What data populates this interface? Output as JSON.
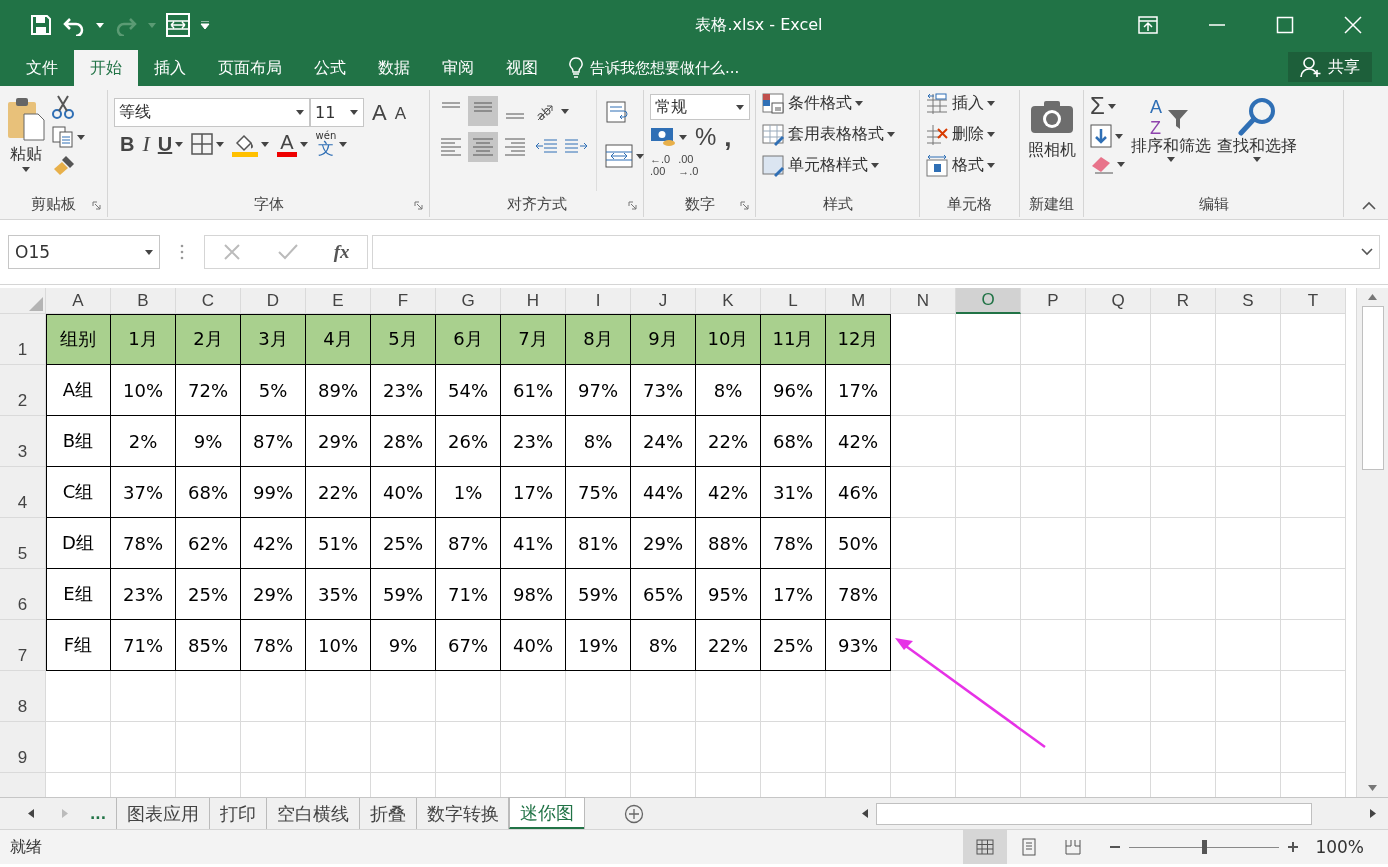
{
  "window": {
    "title": "表格.xlsx - Excel"
  },
  "menu_tabs": [
    {
      "label": "文件",
      "selected": false
    },
    {
      "label": "开始",
      "selected": true
    },
    {
      "label": "插入",
      "selected": false
    },
    {
      "label": "页面布局",
      "selected": false
    },
    {
      "label": "公式",
      "selected": false
    },
    {
      "label": "数据",
      "selected": false
    },
    {
      "label": "审阅",
      "selected": false
    },
    {
      "label": "视图",
      "selected": false
    }
  ],
  "tell_me": {
    "placeholder": "告诉我您想要做什么..."
  },
  "share": "共享",
  "ribbon": {
    "clipboard": {
      "label": "剪贴板",
      "paste": "粘贴"
    },
    "font": {
      "label": "字体",
      "font_name": "等线",
      "font_size": "11",
      "grow": "A",
      "shrink": "A",
      "bold": "B",
      "italic": "I",
      "underline": "U",
      "font_color": "A",
      "phonetic_top": "wén",
      "phonetic_bottom": "文"
    },
    "alignment": {
      "label": "对齐方式",
      "orientation": "ab"
    },
    "number": {
      "label": "数字",
      "format": "常规",
      "percent": "%",
      "comma": ",",
      "increase_decimal": [
        "←.0",
        ".00"
      ],
      "decrease_decimal": [
        ".00",
        "→.0"
      ]
    },
    "styles": {
      "label": "样式",
      "items": [
        "条件格式",
        "套用表格格式",
        "单元格样式"
      ]
    },
    "cells": {
      "label": "单元格",
      "items": [
        "插入",
        "删除",
        "格式"
      ]
    },
    "new_group": {
      "label": "新建组",
      "camera": "照相机"
    },
    "editing": {
      "label": "编辑",
      "sum": "Σ",
      "sort_letters": [
        "A",
        "Z"
      ],
      "items": [
        "排序和筛选",
        "查找和选择"
      ]
    }
  },
  "formula_bar": {
    "name_box": "O15",
    "fx": "fx"
  },
  "sheet": {
    "columns": [
      {
        "label": "A",
        "selected": false
      },
      {
        "label": "B",
        "selected": false
      },
      {
        "label": "C",
        "selected": false
      },
      {
        "label": "D",
        "selected": false
      },
      {
        "label": "E",
        "selected": false
      },
      {
        "label": "F",
        "selected": false
      },
      {
        "label": "G",
        "selected": false
      },
      {
        "label": "H",
        "selected": false
      },
      {
        "label": "I",
        "selected": false
      },
      {
        "label": "J",
        "selected": false
      },
      {
        "label": "K",
        "selected": false
      },
      {
        "label": "L",
        "selected": false
      },
      {
        "label": "M",
        "selected": false
      },
      {
        "label": "N",
        "selected": false
      },
      {
        "label": "O",
        "selected": true
      },
      {
        "label": "P",
        "selected": false
      },
      {
        "label": "Q",
        "selected": false
      },
      {
        "label": "R",
        "selected": false
      },
      {
        "label": "S",
        "selected": false
      },
      {
        "label": "T",
        "selected": false
      }
    ],
    "rows": [
      {
        "label": "1",
        "kind": "header",
        "cells": [
          "组别",
          "1月",
          "2月",
          "3月",
          "4月",
          "5月",
          "6月",
          "7月",
          "8月",
          "9月",
          "10月",
          "11月",
          "12月"
        ]
      },
      {
        "label": "2",
        "kind": "data",
        "cells": [
          "A组",
          "10%",
          "72%",
          "5%",
          "89%",
          "23%",
          "54%",
          "61%",
          "97%",
          "73%",
          "8%",
          "96%",
          "17%"
        ]
      },
      {
        "label": "3",
        "kind": "data",
        "cells": [
          "B组",
          "2%",
          "9%",
          "87%",
          "29%",
          "28%",
          "26%",
          "23%",
          "8%",
          "24%",
          "22%",
          "68%",
          "42%"
        ]
      },
      {
        "label": "4",
        "kind": "data",
        "cells": [
          "C组",
          "37%",
          "68%",
          "99%",
          "22%",
          "40%",
          "1%",
          "17%",
          "75%",
          "44%",
          "42%",
          "31%",
          "46%"
        ]
      },
      {
        "label": "5",
        "kind": "data",
        "cells": [
          "D组",
          "78%",
          "62%",
          "42%",
          "51%",
          "25%",
          "87%",
          "41%",
          "81%",
          "29%",
          "88%",
          "78%",
          "50%"
        ]
      },
      {
        "label": "6",
        "kind": "data",
        "cells": [
          "E组",
          "23%",
          "25%",
          "29%",
          "35%",
          "59%",
          "71%",
          "98%",
          "59%",
          "65%",
          "95%",
          "17%",
          "78%"
        ]
      },
      {
        "label": "7",
        "kind": "data",
        "cells": [
          "F组",
          "71%",
          "85%",
          "78%",
          "10%",
          "9%",
          "67%",
          "40%",
          "19%",
          "8%",
          "22%",
          "25%",
          "93%"
        ]
      },
      {
        "label": "8",
        "kind": "empty",
        "cells": []
      },
      {
        "label": "9",
        "kind": "empty",
        "cells": []
      }
    ]
  },
  "sheet_tabs": {
    "more": "...",
    "tabs": [
      {
        "label": "图表应用",
        "selected": false
      },
      {
        "label": "打印",
        "selected": false
      },
      {
        "label": "空白横线",
        "selected": false
      },
      {
        "label": "折叠",
        "selected": false
      },
      {
        "label": "数字转换",
        "selected": false
      },
      {
        "label": "迷你图",
        "selected": true
      }
    ]
  },
  "status_bar": {
    "status": "就绪",
    "views": [
      {
        "kind": "normal",
        "selected": true
      },
      {
        "kind": "page_layout",
        "selected": false
      },
      {
        "kind": "page_break",
        "selected": false
      }
    ],
    "zoom": {
      "level": 0.5,
      "reading": "100%"
    }
  }
}
